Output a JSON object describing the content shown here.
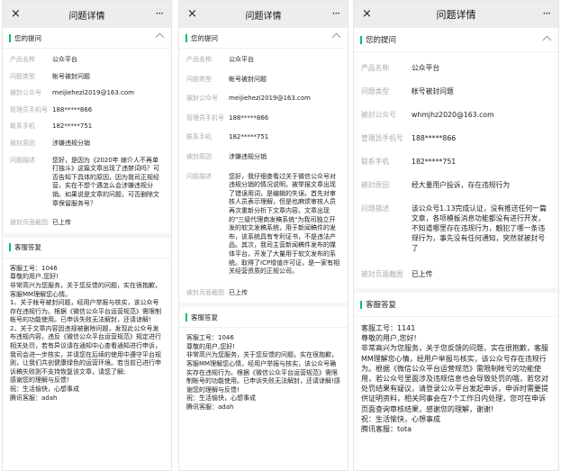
{
  "header": {
    "title": "问题详情",
    "close_icon": "×",
    "more_icon": "···"
  },
  "sections": {
    "question": "您的提问",
    "reply": "客服答复"
  },
  "labels": {
    "product": "产品名称",
    "type": "问题类型",
    "account": "被封公众号",
    "phone": "管理员手机号",
    "contact": "联系手机",
    "reason": "被封原因",
    "desc": "问题描述",
    "screenshot": "被封页面截图"
  },
  "panels": [
    {
      "product": "公众平台",
      "type": "帐号被封问题",
      "account": "meijiehezi2019@163.com",
      "phone": "188*****866",
      "contact": "182*****751",
      "reason": "涉嫌违规分销",
      "desc": "您好，是因为《2020年 嫁介人不再单打独斗》这篇文章出现了违禁词吗？可否告知下具体的原因，因为我司正规经营，实在不想个遇怎么会涉嫌违规分销。如果说是文章的问题，可否删除文章保留服务号？",
      "screenshot": "已上传",
      "reply": [
        "客服工号：1046",
        "尊敬的用户,您好!",
        "非常高兴为您服务，关于您反馈的问题，实在很抱歉，客服MM理解您心情。",
        "1、关于帐号被封问题，经用户举报与核实，该公众号存在违规行为。根据《微信公众平台运营规范》需限制帐号的功能使用。已申诉失败无法解封，还请谅解!",
        "2、关于文章内容因违规被删除问题，发现此公众号发布违规内容，违反《微信公众平台运营规范》规定进行相关处罚，若有异议请在通知中心查看通知进行申诉，我司会进一步核实，并请您在后续的使用中遵守平台规则，让我们共创健康绿色的运营环境。若当前已进行申诉稿失败则不支持恢复该文章，请您了解;",
        "感谢您的理解与反馈!",
        "祝：生活愉快，心想事成",
        "腾讯客服：adah"
      ]
    },
    {
      "product": "公众平台",
      "type": "帐号被封问题",
      "account": "meijiehezi2019@163.com",
      "phone": "188*****866",
      "contact": "182*****751",
      "reason": "涉嫌违规分销",
      "desc": "您好，我仔细查看过关于微信公众号对违规分销的情况说明，被举报文章出现了错误用词，是编辑的失误。首先对审核人员表示理解，但是也麻烦审核人员再次重新分析下文章内容。文章出现的\"三级代理商发稿系统\"为我司独立开发的软文发稿系统，用于新闻稿件的发布，该系统具有专利证书，不是违法产品。其次，我司主营新闻稿件发布的媒体平台，开发了大量用于软文发布的系统。取得了ICP增值许可证，是一家有相关经营资质的正规公司。",
      "screenshot": "已上传",
      "reply": [
        "客服工号：1046",
        "尊敬的用户,您好!",
        "非常高兴为您服务，关于您反馈的问题，实在很抱歉，客服MM理解您心情，经用户举报与核实，该公众号确实存在违规行为。根据《微信公众平台运营规范》需限制帐号的功能使用。已申诉失败无法解封，还请谅解!感谢您的理解与反馈!",
        "祝：生活愉快，心想事成",
        "腾讯客服：adah"
      ]
    },
    {
      "product": "公众平台",
      "type": "帐号被封问题",
      "account": "whmjhz2020@163.com",
      "phone": "188*****866",
      "contact": "182*****751",
      "reason": "经大量用户投诉，存在违规行为",
      "desc": "该公众号1.13完成认证，没有推送任何一篇文章，各项模板消息功能都没有进行开发，不知道哪里存在违规行为，触犯了哪一条违规行为，事先没有任何通知，突然就被封号了",
      "screenshot": "已上传",
      "reply": [
        "客服工号：1141",
        "尊敬的用户,您好!",
        "非常高兴为您服务，关于您反馈的问题，实在很抱歉，客服MM理解您心情，经用户举报与核实，该公众号存在违规行为。根据《微信公众平台运营规范》需限制帐号的功能使用，若公众号里面涉及违规信息也会导致处罚的哦，若您对处罚结果有疑议，请登录公众平台发起申诉，申诉时需要提供证明资料，相关同事会在7个工作日内处理，您可在申诉页面查询审核结果，感谢您的理解，谢谢!",
        "祝：生活愉快，心想事成",
        "腾讯客服：tota"
      ]
    }
  ]
}
